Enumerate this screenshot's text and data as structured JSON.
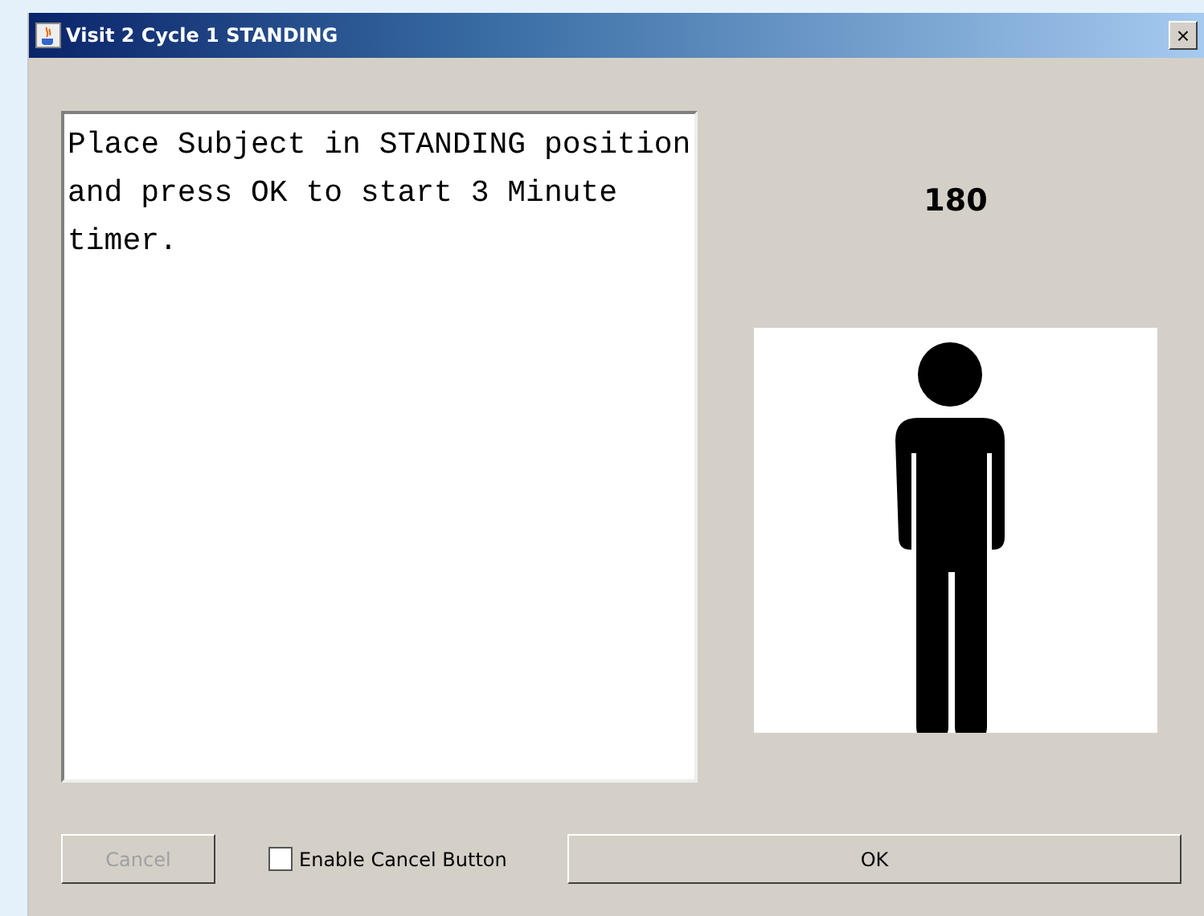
{
  "window": {
    "title": "Visit 2 Cycle 1 STANDING",
    "close": "×"
  },
  "instructions": "Place Subject in STANDING position and press OK to start 3 Minute timer.",
  "timer": "180",
  "cancel_button": {
    "label": "Cancel",
    "disabled": true
  },
  "enable_cancel": {
    "label": "Enable Cancel Button",
    "checked": false
  },
  "ok_button": {
    "label": "OK"
  }
}
